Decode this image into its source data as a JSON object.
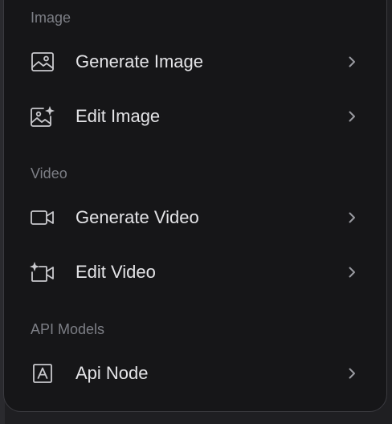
{
  "menu": {
    "sections": [
      {
        "label": "Image",
        "items": [
          {
            "label": "Generate Image",
            "icon": "image-icon"
          },
          {
            "label": "Edit Image",
            "icon": "image-sparkle-icon"
          }
        ]
      },
      {
        "label": "Video",
        "items": [
          {
            "label": "Generate Video",
            "icon": "video-camera-icon"
          },
          {
            "label": "Edit Video",
            "icon": "video-sparkle-icon"
          }
        ]
      },
      {
        "label": "API Models",
        "items": [
          {
            "label": "Api Node",
            "icon": "letter-a-box-icon"
          }
        ]
      }
    ]
  },
  "colors": {
    "background": "#161618",
    "text": "#e4e4e7",
    "section_label": "#7d7f86",
    "icon": "#c9c9cd"
  }
}
